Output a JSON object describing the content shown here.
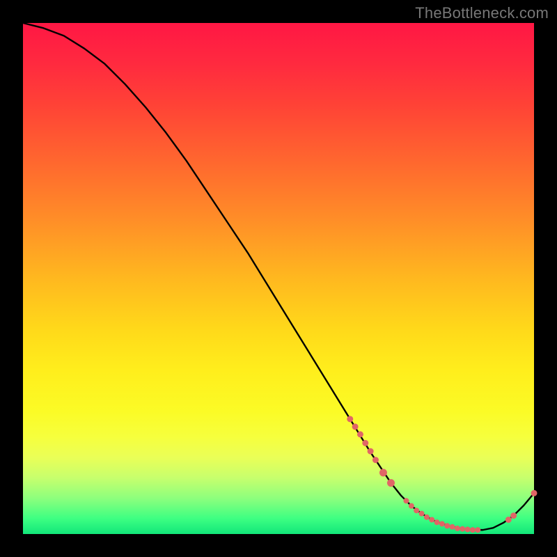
{
  "watermark": "TheBottleneck.com",
  "colors": {
    "background": "#000000",
    "curve_stroke": "#000000",
    "point_fill": "#e06666",
    "point_stroke": "#e06666"
  },
  "chart_data": {
    "type": "line",
    "title": "",
    "xlabel": "",
    "ylabel": "",
    "xlim": [
      0,
      100
    ],
    "ylim": [
      0,
      100
    ],
    "series": [
      {
        "name": "curve",
        "x": [
          0,
          4,
          8,
          12,
          16,
          20,
          24,
          28,
          32,
          36,
          40,
          44,
          48,
          52,
          56,
          60,
          64,
          68,
          70,
          72,
          74,
          76,
          78,
          80,
          82,
          84,
          86,
          88,
          90,
          92,
          94,
          96,
          98,
          100
        ],
        "y": [
          100,
          99,
          97.5,
          95,
          92,
          88,
          83.5,
          78.5,
          73,
          67,
          61,
          55,
          48.5,
          42,
          35.5,
          29,
          22.5,
          16,
          13,
          10,
          7.5,
          5.5,
          4,
          2.8,
          2,
          1.4,
          1,
          0.8,
          0.8,
          1.2,
          2.2,
          3.6,
          5.6,
          8
        ]
      }
    ],
    "points": [
      {
        "x": 64,
        "y": 22.5,
        "r": 4
      },
      {
        "x": 65,
        "y": 21,
        "r": 4
      },
      {
        "x": 66,
        "y": 19.5,
        "r": 4
      },
      {
        "x": 67,
        "y": 17.8,
        "r": 4
      },
      {
        "x": 68,
        "y": 16.2,
        "r": 4
      },
      {
        "x": 69,
        "y": 14.5,
        "r": 4
      },
      {
        "x": 70.5,
        "y": 12,
        "r": 5
      },
      {
        "x": 72,
        "y": 10,
        "r": 5
      },
      {
        "x": 75,
        "y": 6.5,
        "r": 3.5
      },
      {
        "x": 76,
        "y": 5.5,
        "r": 3.5
      },
      {
        "x": 77,
        "y": 4.6,
        "r": 3.5
      },
      {
        "x": 78,
        "y": 4,
        "r": 3.5
      },
      {
        "x": 79,
        "y": 3.3,
        "r": 3.5
      },
      {
        "x": 80,
        "y": 2.8,
        "r": 3.5
      },
      {
        "x": 81,
        "y": 2.3,
        "r": 3.5
      },
      {
        "x": 82,
        "y": 2,
        "r": 3.5
      },
      {
        "x": 83,
        "y": 1.6,
        "r": 3.5
      },
      {
        "x": 84,
        "y": 1.4,
        "r": 3.5
      },
      {
        "x": 85,
        "y": 1.1,
        "r": 3.5
      },
      {
        "x": 86,
        "y": 1,
        "r": 3.5
      },
      {
        "x": 87,
        "y": 0.9,
        "r": 3.5
      },
      {
        "x": 88,
        "y": 0.8,
        "r": 3.5
      },
      {
        "x": 89,
        "y": 0.8,
        "r": 3.5
      },
      {
        "x": 95,
        "y": 2.8,
        "r": 4
      },
      {
        "x": 96,
        "y": 3.6,
        "r": 4
      },
      {
        "x": 100,
        "y": 8,
        "r": 4
      }
    ]
  }
}
